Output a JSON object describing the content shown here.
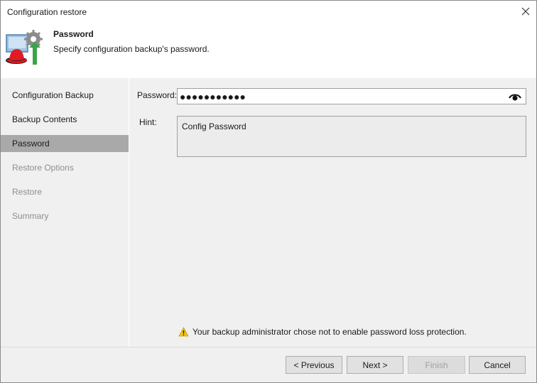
{
  "window": {
    "title": "Configuration restore"
  },
  "header": {
    "title": "Password",
    "subtitle": "Specify configuration backup's password."
  },
  "sidebar": {
    "items": [
      {
        "label": "Configuration Backup",
        "state": "normal"
      },
      {
        "label": "Backup Contents",
        "state": "normal"
      },
      {
        "label": "Password",
        "state": "active"
      },
      {
        "label": "Restore Options",
        "state": "disabled"
      },
      {
        "label": "Restore",
        "state": "disabled"
      },
      {
        "label": "Summary",
        "state": "disabled"
      }
    ]
  },
  "form": {
    "password_label": "Password:",
    "password_value": "●●●●●●●●●●●",
    "hint_label": "Hint:",
    "hint_value": "Config Password"
  },
  "warning": {
    "icon": "warning-triangle-icon",
    "text": "Your backup administrator chose not to enable password loss protection."
  },
  "buttons": {
    "previous": "< Previous",
    "next": "Next >",
    "finish": "Finish",
    "cancel": "Cancel"
  },
  "colors": {
    "active_nav": "#a9a9a9",
    "panel_bg": "#f0f0f0",
    "disabled_text": "#8e8e8e",
    "warning_yellow": "#f5c518"
  }
}
